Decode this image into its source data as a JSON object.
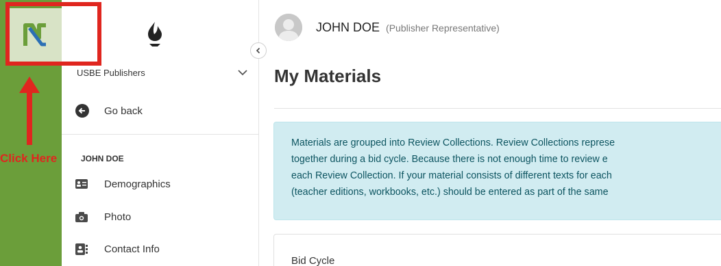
{
  "annotation": {
    "callout_text": "Click Here",
    "highlight_color": "#e0261f"
  },
  "rail": {
    "app_logo_icon": "app-logo-n-icon",
    "color": "#6b9e3a"
  },
  "sidebar": {
    "brand_icon": "flame-logo-icon",
    "org_select": {
      "label": "USBE Publishers",
      "icon": "chevron-down-icon"
    },
    "back": {
      "label": "Go back",
      "icon": "arrow-left-circle-icon"
    },
    "section_heading": "JOHN DOE",
    "items": [
      {
        "label": "Demographics",
        "icon": "id-card-icon"
      },
      {
        "label": "Photo",
        "icon": "camera-icon"
      },
      {
        "label": "Contact Info",
        "icon": "address-book-icon"
      }
    ],
    "collapse_icon": "chevron-left-icon"
  },
  "header": {
    "user_name": "JOHN DOE",
    "user_role": "(Publisher Representative)",
    "avatar_icon": "user-avatar-icon"
  },
  "main": {
    "page_title": "My Materials",
    "info_lines": [
      "Materials are grouped into Review Collections. Review Collections represe",
      "together during a bid cycle. Because there is not enough time to review e",
      "each Review Collection. If your material consists of different texts for each",
      "(teacher editions, workbooks, etc.) should be entered as part of the same"
    ],
    "card_title": "Bid Cycle"
  }
}
